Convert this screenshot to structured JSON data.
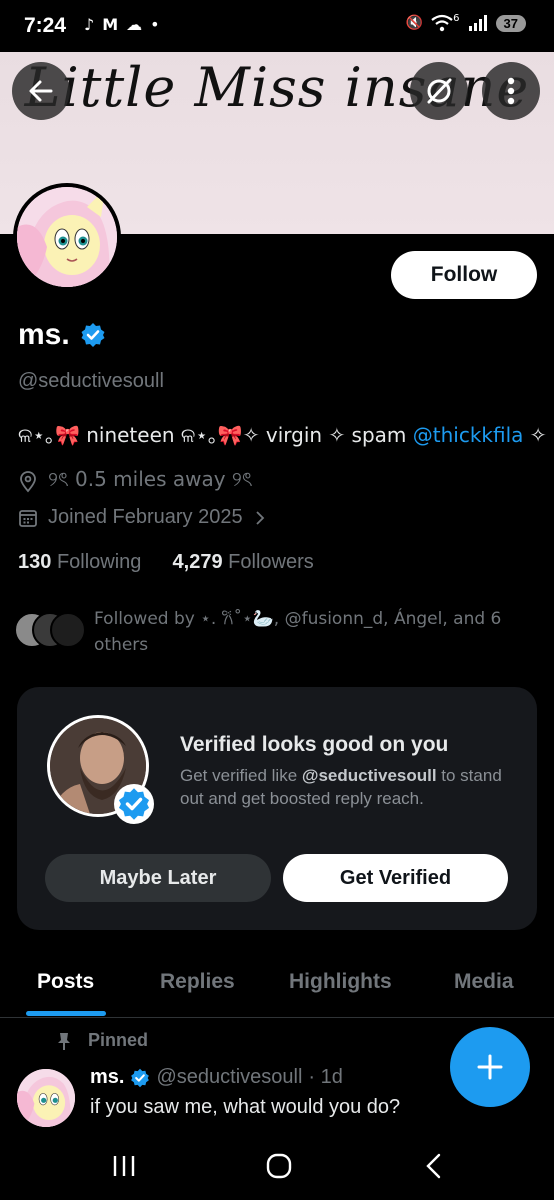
{
  "status_bar": {
    "time": "7:24",
    "left_icons": [
      "tiktok-icon",
      "gmail-icon",
      "weather-icon",
      "dot-icon"
    ],
    "right_icons": [
      "mute-icon",
      "wifi-icon",
      "signal-icon"
    ],
    "wifi_label": "6",
    "battery": "37"
  },
  "banner": {
    "text": "Little Miss insane"
  },
  "profile": {
    "follow_label": "Follow",
    "name": "ms.",
    "handle": "@seductivesoull",
    "bio_text": "ଳ⋆｡🎀 nineteen ଳ⋆｡🎀✧ virgin ✧ spam ",
    "bio_link": "@thickkfila",
    "bio_tail": " ✧",
    "location": "୨ৎ 0.5 miles away ୨ৎ",
    "joined": "Joined February 2025",
    "following_count": "130",
    "following_label": "Following",
    "followers_count": "4,279",
    "followers_label": "Followers",
    "followed_by": "Followed by ⋆. 𐙚˚⋆🦢, @fusionn_d, Ángel, and 6 others"
  },
  "promo": {
    "title": "Verified looks good on you",
    "desc_pre": "Get verified like ",
    "desc_handle": "@seductivesoull",
    "desc_post": " to stand out and get boosted reply reach.",
    "maybe_label": "Maybe Later",
    "get_label": "Get Verified"
  },
  "tabs": [
    "Posts",
    "Replies",
    "Highlights",
    "Media"
  ],
  "active_tab": "Posts",
  "pinned_post": {
    "pinned_label": "Pinned",
    "name": "ms.",
    "handle": "@seductivesoull",
    "time": "· 1d",
    "text": "if you saw me, what would you do?"
  },
  "colors": {
    "accent": "#1d9bf0",
    "background": "#000000",
    "muted_text": "#71767b",
    "card_bg": "#16181c"
  }
}
